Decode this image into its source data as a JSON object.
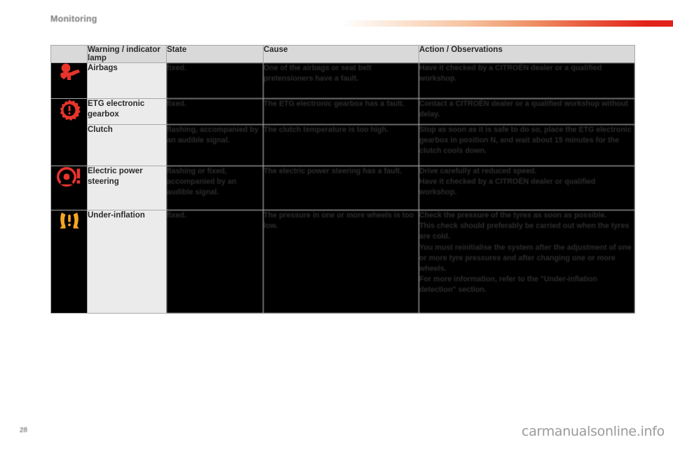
{
  "header": {
    "chapter_title": "Monitoring",
    "rule_gradient_from": "#ffffff",
    "rule_gradient_to": "#e2231a"
  },
  "table": {
    "columns": [
      "",
      "Warning / indicator lamp",
      "State",
      "Cause",
      "Action / Observations"
    ],
    "rows": [
      {
        "icon": "airbag-warning-icon",
        "icon_color": "#e8342c",
        "lamp": "Airbags",
        "state": "fixed.",
        "cause": "One of the airbags or seat belt pretensioners have a fault.",
        "action": "Have it checked by a CITROËN dealer or a qualified workshop."
      },
      {
        "icon": "etg-gearbox-warning-icon",
        "icon_color": "#e8342c",
        "lamp": "ETG electronic gearbox",
        "state": "fixed.",
        "cause": "The ETG electronic gearbox has a fault.",
        "action": "Contact a CITROËN dealer or a qualified workshop without delay."
      },
      {
        "icon": "",
        "icon_color": "",
        "lamp": "Clutch",
        "state": "flashing, accompanied by an audible signal.",
        "cause": "The clutch temperature is too high.",
        "action": "Stop as soon as it is safe to do so, place the ETG electronic gearbox in position N, and wait about 15 minutes for the clutch cools down."
      },
      {
        "icon": "power-steering-warning-icon",
        "icon_color": "#e8342c",
        "lamp": "Electric power steering",
        "state": "flashing or fixed, accompanied by an audible signal.",
        "cause": "The electric power steering has a fault.",
        "action": "Drive carefully at reduced speed.\nHave it checked by a CITROËN dealer or qualified workshop."
      },
      {
        "icon": "tyre-under-inflation-icon",
        "icon_color": "#f5a623",
        "lamp": "Under-inflation",
        "state": "fixed.",
        "cause": "The pressure in one or more wheels is too low.",
        "action": "Check the pressure of the tyres as soon as possible.\nThis check should preferably be carried out when the tyres are cold.\nYou must reinitialise the system after the adjustment of one or more tyre pressures and after changing one or more wheels.\nFor more information, refer to the \"Under-inflation detection\" section."
      }
    ]
  },
  "footer": {
    "page_number": "28",
    "watermark": "carmanualsonline.info"
  }
}
